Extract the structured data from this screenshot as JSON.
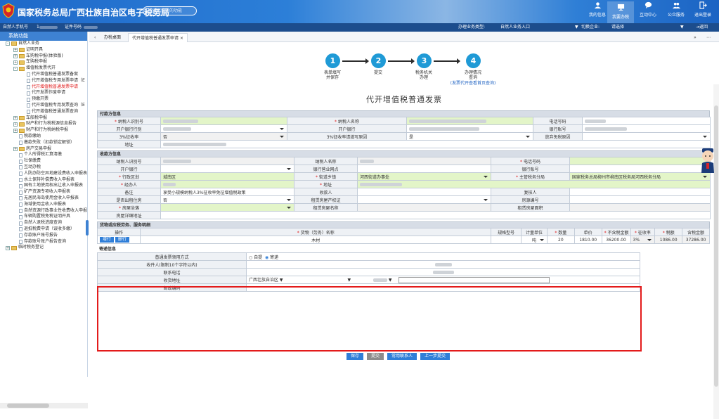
{
  "header": {
    "brand": "国家税务总局广西壮族自治区电子税务局",
    "search_placeholder": "搜索您需要的功能",
    "nav": [
      {
        "label": "我的信息",
        "icon": "user-icon"
      },
      {
        "label": "我要办税",
        "icon": "monitor-icon",
        "active": true
      },
      {
        "label": "互动中心",
        "icon": "chat-icon"
      },
      {
        "label": "公众服务",
        "icon": "people-icon"
      },
      {
        "label": "退出登录",
        "icon": "logout-icon"
      }
    ]
  },
  "infobar": {
    "phone_label": "自然人手机号",
    "phone_value": "1",
    "cert_label": "证件号码",
    "business_type_label": "办理业务类型:",
    "business_type_value": "自然人业务入口",
    "switch_label": "切换企业:",
    "switch_value": "请选择",
    "back_label": "返回"
  },
  "sidebar": {
    "title": "系统功能",
    "items": [
      {
        "t": "自然人业务",
        "lv": 0,
        "k": "f",
        "bx": "-"
      },
      {
        "t": "证明开具",
        "lv": 1,
        "k": "f",
        "bx": "+"
      },
      {
        "t": "车购税申报(体验版)",
        "lv": 1,
        "k": "f",
        "bx": "+"
      },
      {
        "t": "车购税申报",
        "lv": 1,
        "k": "f",
        "bx": "+"
      },
      {
        "t": "增值税发票代开",
        "lv": 1,
        "k": "f",
        "bx": "-"
      },
      {
        "t": "代开增值税普通发票备案",
        "lv": 2,
        "k": "p"
      },
      {
        "t": "代开增值税专用发票申请（E",
        "lv": 2,
        "k": "p"
      },
      {
        "t": "代开增值税普通发票申请",
        "lv": 2,
        "k": "p",
        "red": true
      },
      {
        "t": "代开发票作废申请",
        "lv": 2,
        "k": "p"
      },
      {
        "t": "预缴开票",
        "lv": 2,
        "k": "p"
      },
      {
        "t": "代开增值税专用发票查询（E",
        "lv": 2,
        "k": "p"
      },
      {
        "t": "代开增值税普通发票查询",
        "lv": 2,
        "k": "p"
      },
      {
        "t": "车船税申报",
        "lv": 1,
        "k": "f",
        "bx": "+"
      },
      {
        "t": "财产和行为税税源信息报告",
        "lv": 1,
        "k": "f",
        "bx": "+"
      },
      {
        "t": "财产和行为税纳税申报",
        "lv": 1,
        "k": "f",
        "bx": "+"
      },
      {
        "t": "税款缴纳",
        "lv": 1,
        "k": "p"
      },
      {
        "t": "缴款失败（扣款锁定解锁）",
        "lv": 1,
        "k": "p"
      },
      {
        "t": "房产交易申报",
        "lv": 1,
        "k": "f",
        "bx": "+"
      },
      {
        "t": "个人所得税汇算清缴",
        "lv": 1,
        "k": "p"
      },
      {
        "t": "社保缴费",
        "lv": 1,
        "k": "p"
      },
      {
        "t": "互动办税",
        "lv": 1,
        "k": "p"
      },
      {
        "t": "人防办防空异地建设费收入申报表",
        "lv": 1,
        "k": "p"
      },
      {
        "t": "水土保持补偿费收入申报表",
        "lv": 1,
        "k": "p"
      },
      {
        "t": "国有土地使用权出让收入申报表",
        "lv": 1,
        "k": "p"
      },
      {
        "t": "矿产资源专项收入申报表",
        "lv": 1,
        "k": "p"
      },
      {
        "t": "无居民海岛使用金收入申报表",
        "lv": 1,
        "k": "p"
      },
      {
        "t": "海域使用金收入申报表",
        "lv": 1,
        "k": "p"
      },
      {
        "t": "自然资源行政事业性收费收入申报",
        "lv": 1,
        "k": "p"
      },
      {
        "t": "车辆购置税免税证明开具",
        "lv": 1,
        "k": "p"
      },
      {
        "t": "自然人退税进度查询",
        "lv": 1,
        "k": "p"
      },
      {
        "t": "退抵税费申请（误收多缴）",
        "lv": 1,
        "k": "p"
      },
      {
        "t": "存款账户账号报告",
        "lv": 1,
        "k": "p"
      },
      {
        "t": "存款账号账户报告查询",
        "lv": 1,
        "k": "p"
      },
      {
        "t": "临时税务登记",
        "lv": 0,
        "k": "f",
        "bx": "+"
      }
    ]
  },
  "tabs": {
    "home": "办税桌面",
    "active": "代开增值税普通发票申请"
  },
  "steps": [
    {
      "n": "1",
      "label": "表单填写\n并保存"
    },
    {
      "n": "2",
      "label": "提交"
    },
    {
      "n": "3",
      "label": "税务机关\n办理"
    },
    {
      "n": "4",
      "label": "办理情况\n查询",
      "link": "(发票代开查看首页查询)"
    }
  ],
  "form_title": "代开增值税普通发票",
  "payer": {
    "section": "付款方信息",
    "r1": [
      "纳税人识别号",
      "纳税人名称",
      "电话号码"
    ],
    "r2": [
      "开户银行行别",
      "开户银行",
      "银行账号"
    ],
    "r3": [
      "3%征收率",
      "3%征收率请填写原因",
      "放弃免税原因"
    ],
    "r3v": [
      "否",
      "是"
    ],
    "addr": "地址"
  },
  "payee": {
    "section": "收款方信息",
    "r1": [
      "纳税人识别号",
      "纳税人名称",
      "电话号码"
    ],
    "r2": [
      "开户银行",
      "银行营业网点",
      "银行账号"
    ],
    "r3": [
      "行政区划",
      "街道乡镇",
      "主管税务分局"
    ],
    "r3v": [
      "城南区",
      "河西街道办事处",
      "国家税务总局柳州市柳南区税务局河西税务分局"
    ],
    "r4": [
      "经办人",
      "地址"
    ],
    "r5": [
      "备注",
      "收款人",
      "复核人"
    ],
    "r5v": "享受小规模纳税人3%征收率免征增值税政策",
    "r6": [
      "是否出租住房",
      "租赁房屋产权证",
      "房源编号"
    ],
    "r6v": "否",
    "r7": [
      "房屋坐落",
      "租赁房屋名称",
      "租赁房屋面积"
    ],
    "r8": "房屋详细地址"
  },
  "goods": {
    "section": "货物或应税劳务、服务明细",
    "cols": [
      "操作",
      "货物（劳务）名称",
      "规格型号",
      "计量单位",
      "数量",
      "单价",
      "不含税金额",
      "征收率",
      "税额",
      "含税金额"
    ],
    "add": "增行",
    "del": "删行",
    "row": {
      "name": "木材",
      "unit": "吨",
      "qty": "20",
      "price": "1810.00",
      "amount": "36200.00",
      "rate": "3%",
      "tax": "1086.00",
      "total": "37286.00"
    }
  },
  "mail": {
    "section": "寄递信息",
    "rows": [
      "普通发票领用方式",
      "收件人(限制10个字符以内)",
      "联系电话",
      "收货地址",
      "邮政编码"
    ],
    "self": "自提",
    "post": "寄递",
    "province": "广西壮族自治区"
  },
  "buttons": [
    "保存",
    "提交",
    "常用联系人",
    "上一步提交"
  ],
  "colors": {
    "accent": "#2f7ed8",
    "required_fill": "#e3f5c8",
    "highlight_box": "#e31b1b"
  }
}
